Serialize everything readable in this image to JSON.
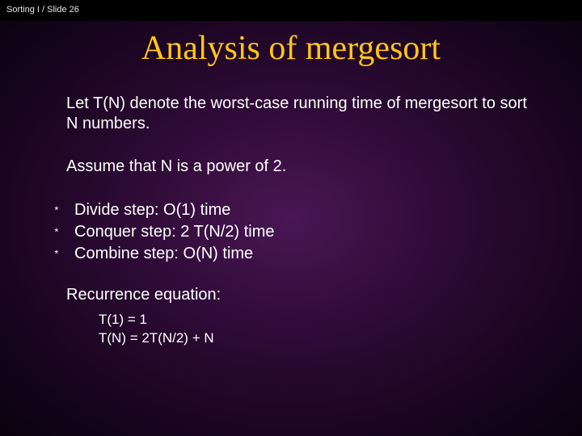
{
  "header": {
    "course": "Sorting I",
    "slide_label": "/ Slide 26"
  },
  "title": "Analysis of mergesort",
  "para1": "Let T(N) denote the worst-case running time of mergesort to sort N numbers.",
  "para2": "Assume that N is a power of 2.",
  "bullets": [
    "Divide step: O(1) time",
    "Conquer step: 2 T(N/2) time",
    "Combine step: O(N) time"
  ],
  "recurrence": {
    "heading": "Recurrence equation:",
    "eq1": "T(1) = 1",
    "eq2": "T(N) = 2T(N/2) + N"
  }
}
